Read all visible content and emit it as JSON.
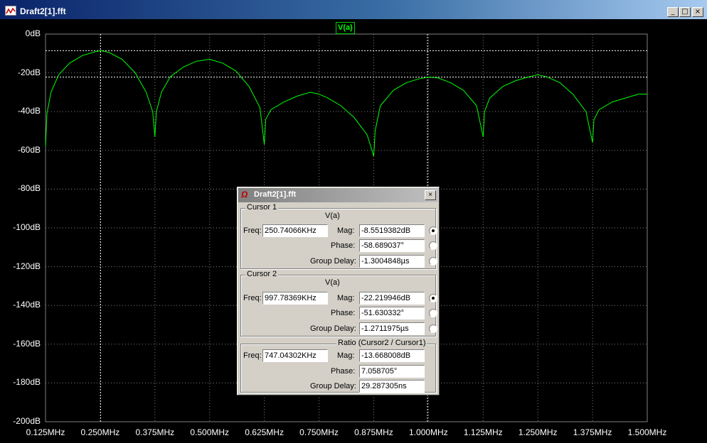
{
  "window": {
    "title": "Draft2[1].fft",
    "icon": "waveform-icon",
    "minimize": "_",
    "restore": "□",
    "close": "×"
  },
  "plot": {
    "trace_label": "V(a)",
    "y_ticks": [
      "0dB",
      "-20dB",
      "-40dB",
      "-60dB",
      "-80dB",
      "-100dB",
      "-120dB",
      "-140dB",
      "-160dB",
      "-180dB",
      "-200dB"
    ],
    "x_ticks": [
      "0.125MHz",
      "0.250MHz",
      "0.375MHz",
      "0.500MHz",
      "0.625MHz",
      "0.750MHz",
      "0.875MHz",
      "1.000MHz",
      "1.125MHz",
      "1.250MHz",
      "1.375MHz",
      "1.500MHz"
    ],
    "grid_color": "#808080",
    "trace_color": "#00ff00"
  },
  "chart_data": {
    "type": "line",
    "xlabel": "",
    "ylabel": "",
    "xlim": [
      0.125,
      1.5
    ],
    "ylim": [
      -200,
      0
    ],
    "series": [
      {
        "name": "V(a)",
        "x": [
          0.125,
          0.1282,
          0.1375,
          0.155,
          0.18,
          0.21,
          0.24,
          0.2507,
          0.27,
          0.3,
          0.33,
          0.355,
          0.37,
          0.375,
          0.3782,
          0.39,
          0.41,
          0.44,
          0.47,
          0.5,
          0.53,
          0.56,
          0.59,
          0.615,
          0.625,
          0.6282,
          0.64,
          0.67,
          0.7,
          0.73,
          0.75,
          0.77,
          0.8,
          0.83,
          0.86,
          0.875,
          0.8782,
          0.89,
          0.92,
          0.95,
          0.98,
          0.9978,
          1.02,
          1.05,
          1.08,
          1.11,
          1.125,
          1.1282,
          1.14,
          1.17,
          1.2,
          1.23,
          1.25,
          1.27,
          1.3,
          1.33,
          1.36,
          1.375,
          1.3782,
          1.39,
          1.42,
          1.45,
          1.48,
          1.5
        ],
        "y": [
          -58,
          -41,
          -30,
          -21,
          -15,
          -11,
          -9,
          -8.55,
          -9.5,
          -13,
          -20,
          -30,
          -40,
          -53,
          -40,
          -30,
          -22,
          -17,
          -14,
          -13,
          -15,
          -19,
          -27,
          -38,
          -57,
          -44,
          -39,
          -35,
          -32,
          -30,
          -31,
          -33,
          -37,
          -43,
          -52,
          -63,
          -50,
          -37,
          -29,
          -25,
          -23,
          -22.22,
          -22.5,
          -25,
          -29,
          -37,
          -53,
          -40,
          -33,
          -27,
          -24,
          -22,
          -21,
          -22,
          -25,
          -31,
          -40,
          -56,
          -44,
          -39,
          -35,
          -33,
          -31,
          -31
        ]
      }
    ],
    "cursors": [
      {
        "name": "Cursor 1",
        "x": 0.2507,
        "y": -8.55
      },
      {
        "name": "Cursor 2",
        "x": 0.9978,
        "y": -22.22
      }
    ]
  },
  "dialog": {
    "title": "Draft2[1].fft",
    "cursor1": {
      "title": "Cursor 1",
      "trace": "V(a)",
      "freq_label": "Freq:",
      "freq": "250.74066KHz",
      "mag_label": "Mag:",
      "mag": "-8.5519382dB",
      "phase_label": "Phase:",
      "phase": "-58.689037°",
      "gd_label": "Group Delay:",
      "gd": "-1.3004848µs"
    },
    "cursor2": {
      "title": "Cursor 2",
      "trace": "V(a)",
      "freq_label": "Freq:",
      "freq": "997.78369KHz",
      "mag_label": "Mag:",
      "mag": "-22.219946dB",
      "phase_label": "Phase:",
      "phase": "-51.630332°",
      "gd_label": "Group Delay:",
      "gd": "-1.2711975µs"
    },
    "ratio": {
      "title": "Ratio (Cursor2 / Cursor1)",
      "freq_label": "Freq:",
      "freq": "747.04302KHz",
      "mag_label": "Mag:",
      "mag": "-13.668008dB",
      "phase_label": "Phase:",
      "phase": "7.058705°",
      "gd_label": "Group Delay:",
      "gd": "29.287305ns"
    },
    "close": "×"
  }
}
